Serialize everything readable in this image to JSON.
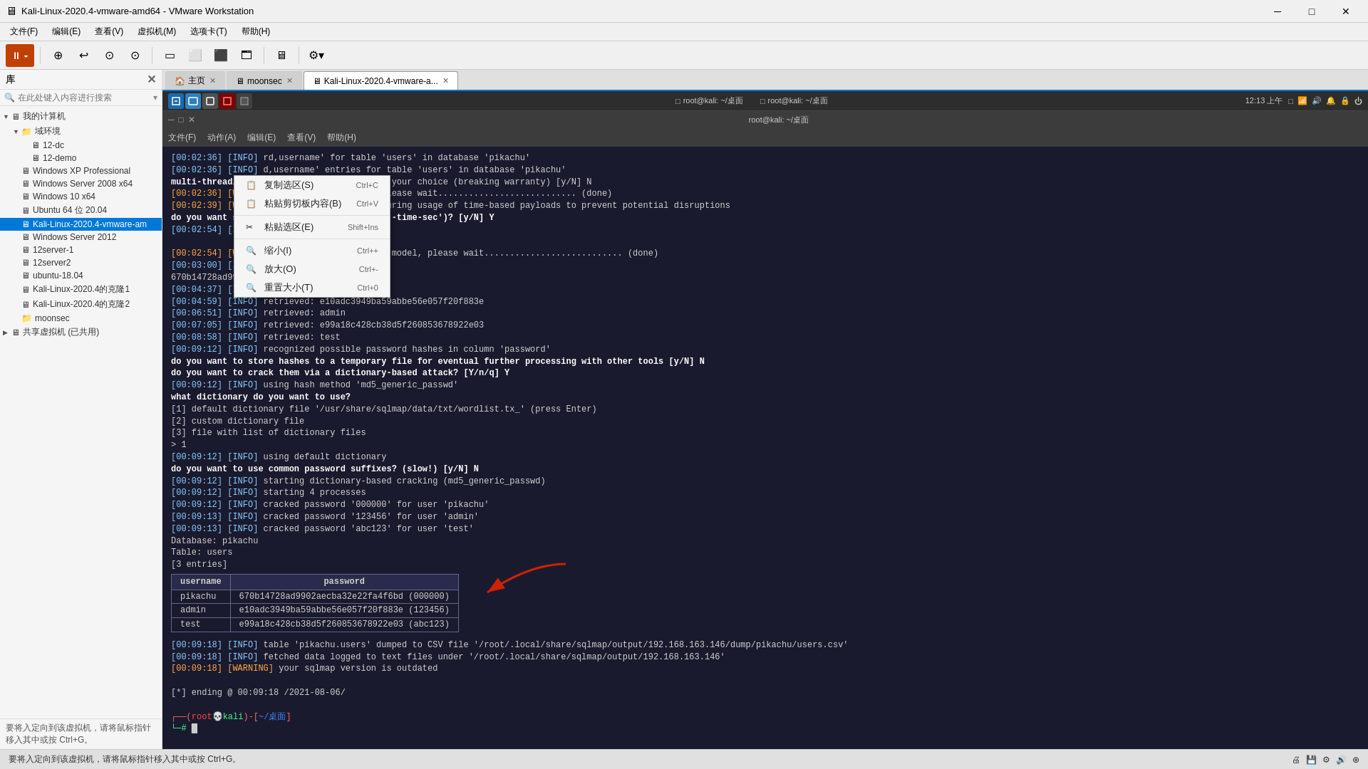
{
  "titleBar": {
    "title": "Kali-Linux-2020.4-vmware-amd64 - VMware Workstation",
    "iconGlyph": "🖥",
    "controls": [
      "─",
      "□",
      "✕"
    ]
  },
  "menuBar": {
    "items": [
      "文件(F)",
      "编辑(E)",
      "查看(V)",
      "虚拟机(M)",
      "选项卡(T)",
      "帮助(H)"
    ]
  },
  "toolbar": {
    "pauseLabel": "⏸",
    "buttons": [
      "⊕",
      "↩",
      "⊙",
      "⊙",
      "□",
      "□⬜",
      "⬜⬜",
      "🗔",
      "🖥",
      "⚙"
    ]
  },
  "sidebar": {
    "header": "库",
    "searchPlaceholder": "在此处键入内容进行搜索",
    "items": [
      {
        "id": "my-computer",
        "label": "我的计算机",
        "level": 0,
        "expand": "▼",
        "icon": "🖥"
      },
      {
        "id": "domain-env",
        "label": "域环境",
        "level": 1,
        "expand": "▼",
        "icon": "📁"
      },
      {
        "id": "12-dc",
        "label": "12-dc",
        "level": 2,
        "expand": "",
        "icon": "🖥"
      },
      {
        "id": "12-demo",
        "label": "12-demo",
        "level": 2,
        "expand": "",
        "icon": "🖥"
      },
      {
        "id": "winxp",
        "label": "Windows XP Professional",
        "level": 1,
        "expand": "",
        "icon": "🖥"
      },
      {
        "id": "win2008",
        "label": "Windows Server 2008 x64",
        "level": 1,
        "expand": "",
        "icon": "🖥"
      },
      {
        "id": "win10",
        "label": "Windows 10 x64",
        "level": 1,
        "expand": "",
        "icon": "🖥"
      },
      {
        "id": "ubuntu64",
        "label": "Ubuntu 64 位 20.04",
        "level": 1,
        "expand": "",
        "icon": "🖥"
      },
      {
        "id": "kali-main",
        "label": "Kali-Linux-2020.4-vmware-am",
        "level": 1,
        "expand": "",
        "icon": "🖥",
        "selected": true
      },
      {
        "id": "win2012",
        "label": "Windows Server 2012",
        "level": 1,
        "expand": "",
        "icon": "🖥"
      },
      {
        "id": "12server1",
        "label": "12server-1",
        "level": 1,
        "expand": "",
        "icon": "🖥"
      },
      {
        "id": "12server2",
        "label": "12server2",
        "level": 1,
        "expand": "",
        "icon": "🖥"
      },
      {
        "id": "ubuntu1804",
        "label": "ubuntu-18.04",
        "level": 1,
        "expand": "",
        "icon": "🖥"
      },
      {
        "id": "kali-clone1",
        "label": "Kali-Linux-2020.4的克隆1",
        "level": 1,
        "expand": "",
        "icon": "🖥"
      },
      {
        "id": "kali-clone2",
        "label": "Kali-Linux-2020.4的克隆2",
        "level": 1,
        "expand": "",
        "icon": "🖥"
      },
      {
        "id": "moonsec",
        "label": "moonsec",
        "level": 1,
        "expand": "",
        "icon": "📁"
      },
      {
        "id": "shared-vms",
        "label": "共享虚拟机 (已共用)",
        "level": 0,
        "expand": "▶",
        "icon": "🖥"
      }
    ],
    "bottomText": "要将入定向到该虚拟机，请将鼠标指针移入其中或按 Ctrl+G。"
  },
  "tabs": [
    {
      "id": "home",
      "label": "主页",
      "active": false,
      "closable": true
    },
    {
      "id": "moonsec",
      "label": "moonsec",
      "active": false,
      "closable": true
    },
    {
      "id": "kali",
      "label": "Kali-Linux-2020.4-vmware-a...",
      "active": true,
      "closable": true
    }
  ],
  "vmHeader": {
    "tabs": [
      {
        "label": "root@kali: ~/桌面",
        "active": false
      },
      {
        "label": "root@kali: ~/桌面",
        "active": false
      }
    ],
    "time": "12:13 上午",
    "icons": [
      "□",
      "🔊",
      "🔔",
      "🔒",
      "⏻"
    ]
  },
  "vmTitlebar": {
    "title": "root@kali: ~/桌面",
    "controls": [
      "─",
      "□",
      "✕"
    ]
  },
  "vmFileMenu": {
    "items": [
      "文件(F)",
      "动作(A)",
      "编辑(E)",
      "查看(V)",
      "帮助(H)"
    ]
  },
  "contextMenu": {
    "items": [
      {
        "icon": "📋",
        "label": "复制选区(S)",
        "shortcut": "Ctrl+C"
      },
      {
        "icon": "📋",
        "label": "粘贴剪切板内容(B)",
        "shortcut": "Ctrl+V"
      },
      {
        "sep": false
      },
      {
        "icon": "✂",
        "label": "粘贴选区(E)",
        "shortcut": "Shift+Ins"
      },
      {
        "sep": false
      },
      {
        "icon": "🔍",
        "label": "缩小(I)",
        "shortcut": "Ctrl++"
      },
      {
        "icon": "🔍",
        "label": "放大(O)",
        "shortcut": "Ctrl+-"
      },
      {
        "icon": "🔍",
        "label": "重置大小(T)",
        "shortcut": "Ctrl+0"
      }
    ]
  },
  "terminal": {
    "lines": [
      "[00:02:36] [INFO] rd,username' for table 'users' in database 'pikachu'",
      "[00:02:36] [INFO] d,username' entries for table 'users' in database 'pikachu'",
      "multi-threading retrieval. Are you sure of your choice (breaking warranty) [y/N] N",
      "[00:02:36] [WARN] ger statistical model, please wait........................... (done)",
      "[00:02:39] [WARN] the network connection during usage of time-based payloads to prevent potential disruptions",
      "do you want sqlm delay responses (option '--time-sec')? [y/N] Y",
      "[00:02:54] [INFO] to good response times",
      "",
      "[00:02:54] [WARN] res reset of statistical model, please wait........................... (done)",
      "[00:03:00] [INFO] to good response times",
      "670b14728ad9902aecba32e22ta4f6bd",
      "[00:04:37] [INFO] retrieved: pikachu",
      "[00:04:59] [INFO] retrieved: e10adc3949ba59abbe56e057f20f883e",
      "[00:06:51] [INFO] retrieved: admin",
      "[00:07:05] [INFO] retrieved: e99a18c428cb38d5f260853678922e03",
      "[00:08:58] [INFO] retrieved: test",
      "[00:09:12] [INFO] recognized possible password hashes in column 'password'",
      "do you want to store hashes to a temporary file for eventual further processing with other tools [y/N] N",
      "do you want to crack them via a dictionary-based attack? [Y/n/q] Y",
      "[00:09:12] [INFO] using hash method 'md5_generic_passwd'",
      "what dictionary do you want to use?",
      "[1] default dictionary file '/usr/share/sqlmap/data/txt/wordlist.tx_' (press Enter)",
      "[2] custom dictionary file",
      "[3] file with list of dictionary files",
      "> 1",
      "[00:09:12] [INFO] using default dictionary",
      "do you want to use common password suffixes? (slow!) [y/N] N",
      "[00:09:12] [INFO] starting dictionary-based cracking (md5_generic_passwd)",
      "[00:09:12] [INFO] starting 4 processes",
      "[00:09:12] [INFO] cracked password '000000' for user 'pikachu'",
      "[00:09:13] [INFO] cracked password '123456' for user 'admin'",
      "[00:09:13] [INFO] cracked password 'abc123' for user 'test'",
      "Database: pikachu",
      "Table: users",
      "[3 entries]"
    ],
    "tableHeaders": [
      "username",
      "password"
    ],
    "tableRows": [
      [
        "pikachu",
        "670b14728ad9902aecba32e22fa4f6bd (000000)"
      ],
      [
        "admin",
        "e10adc3949ba59abbe56e057f20f883e (123456)"
      ],
      [
        "test",
        "e99a18c428cb38d5f260853678922e03 (abc123)"
      ]
    ],
    "postLines": [
      "[00:09:18] [INFO] table 'pikachu.users' dumped to CSV file '/root/.local/share/sqlmap/output/192.168.163.146/dump/pikachu/users.csv'",
      "[00:09:18] [INFO] fetched data logged to text files under '/root/.local/share/sqlmap/output/192.168.163.146'",
      "[00:09:18] [WARNING] your sqlmap version is outdated",
      "",
      "[*] ending @ 00:09:18 /2021-08-06/"
    ],
    "prompt": "┌──(root💀kali)-[~/桌面]",
    "promptCursor": "└─#"
  },
  "statusBar": {
    "text": "要将入定向到该虚拟机，请将鼠标指针移入其中或按 Ctrl+G。",
    "icons": [
      "🖨",
      "💾",
      "⚙",
      "🔊",
      "⊕"
    ]
  }
}
